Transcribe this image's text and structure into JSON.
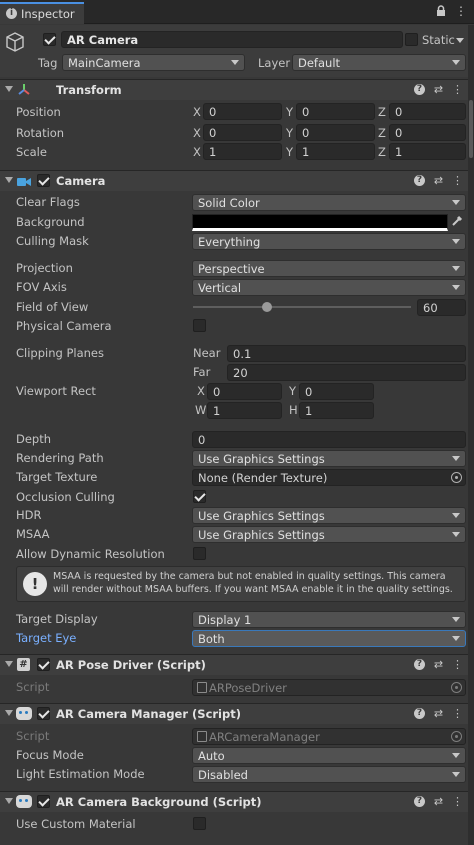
{
  "tab": {
    "title": "Inspector"
  },
  "object": {
    "name": "AR Camera",
    "static_label": "Static",
    "tag_label": "Tag",
    "tag_value": "MainCamera",
    "layer_label": "Layer",
    "layer_value": "Default"
  },
  "transform": {
    "title": "Transform",
    "position_label": "Position",
    "rotation_label": "Rotation",
    "scale_label": "Scale",
    "axis_x": "X",
    "axis_y": "Y",
    "axis_z": "Z",
    "position": [
      "0",
      "0",
      "0"
    ],
    "rotation": [
      "0",
      "0",
      "0"
    ],
    "scale": [
      "1",
      "1",
      "1"
    ]
  },
  "camera": {
    "title": "Camera",
    "clear_flags_label": "Clear Flags",
    "clear_flags": "Solid Color",
    "background_label": "Background",
    "background_color": "#000000",
    "culling_mask_label": "Culling Mask",
    "culling_mask": "Everything",
    "projection_label": "Projection",
    "projection": "Perspective",
    "fov_axis_label": "FOV Axis",
    "fov_axis": "Vertical",
    "fov_label": "Field of View",
    "fov": "60",
    "fov_slider_fraction": 0.34,
    "physical_label": "Physical Camera",
    "clipping_label": "Clipping Planes",
    "near_label": "Near",
    "near": "0.1",
    "far_label": "Far",
    "far": "20",
    "viewport_label": "Viewport Rect",
    "vx_label": "X",
    "vx": "0",
    "vy_label": "Y",
    "vy": "0",
    "vw_label": "W",
    "vw": "1",
    "vh_label": "H",
    "vh": "1",
    "depth_label": "Depth",
    "depth": "0",
    "rendering_path_label": "Rendering Path",
    "rendering_path": "Use Graphics Settings",
    "target_texture_label": "Target Texture",
    "target_texture": "None (Render Texture)",
    "occlusion_label": "Occlusion Culling",
    "hdr_label": "HDR",
    "hdr": "Use Graphics Settings",
    "msaa_label": "MSAA",
    "msaa": "Use Graphics Settings",
    "dynres_label": "Allow Dynamic Resolution",
    "warning": "MSAA is requested by the camera but not enabled in quality settings. This camera will render without MSAA buffers. If you want MSAA enable it in the quality settings.",
    "target_display_label": "Target Display",
    "target_display": "Display 1",
    "target_eye_label": "Target Eye",
    "target_eye": "Both"
  },
  "pose_driver": {
    "title": "AR Pose Driver (Script)",
    "script_label": "Script",
    "script": "ARPoseDriver"
  },
  "camera_manager": {
    "title": "AR Camera Manager (Script)",
    "script_label": "Script",
    "script": "ARCameraManager",
    "focus_label": "Focus Mode",
    "focus": "Auto",
    "light_label": "Light Estimation Mode",
    "light": "Disabled"
  },
  "camera_background": {
    "title": "AR Camera Background (Script)",
    "custom_material_label": "Use Custom Material"
  }
}
